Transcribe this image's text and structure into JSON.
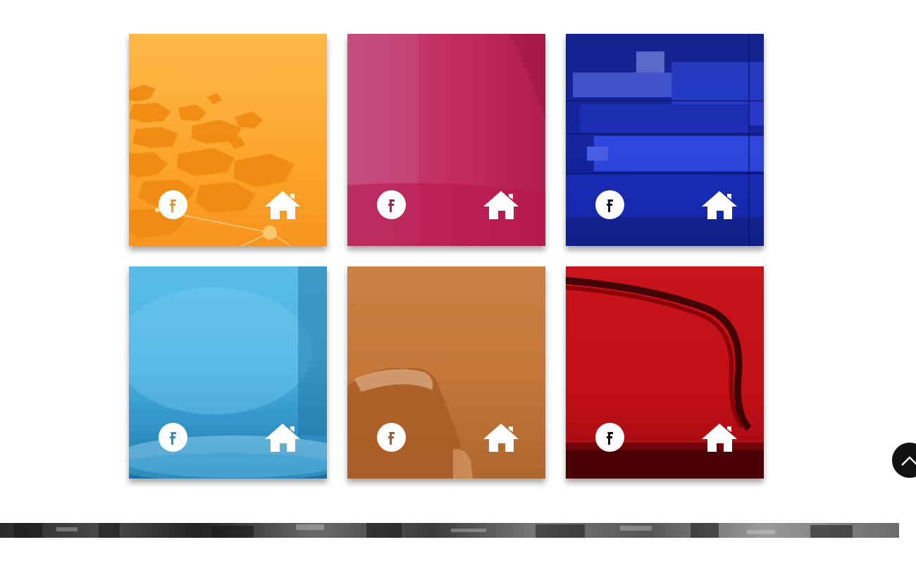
{
  "tiles": [
    {
      "theme": "orange-map",
      "color": "#fca52c",
      "icons": {
        "share": "facebook-icon",
        "home": "home-icon"
      },
      "accent": "#f7941d"
    },
    {
      "theme": "magenta",
      "color": "#c32b60",
      "icons": {
        "share": "facebook-icon",
        "home": "home-icon"
      },
      "accent": "#b01d4f"
    },
    {
      "theme": "blue-server",
      "color": "#1e34c6",
      "icons": {
        "share": "facebook-icon",
        "home": "home-icon"
      },
      "accent": "#15249a"
    },
    {
      "theme": "light-blue",
      "color": "#4ab1e3",
      "icons": {
        "share": "facebook-icon",
        "home": "home-icon"
      },
      "accent": "#2f8fc2"
    },
    {
      "theme": "brown-portrait",
      "color": "#c07032",
      "icons": {
        "share": "facebook-icon",
        "home": "home-icon"
      },
      "accent": "#a45a23"
    },
    {
      "theme": "red-cable",
      "color": "#c10f17",
      "icons": {
        "share": "facebook-icon",
        "home": "home-icon"
      },
      "accent": "#9d0a10"
    }
  ],
  "back_to_top": {
    "icon": "chevron-up-icon",
    "color": "#111111"
  },
  "footer": {
    "theme": "grayscale-photo-strip"
  }
}
